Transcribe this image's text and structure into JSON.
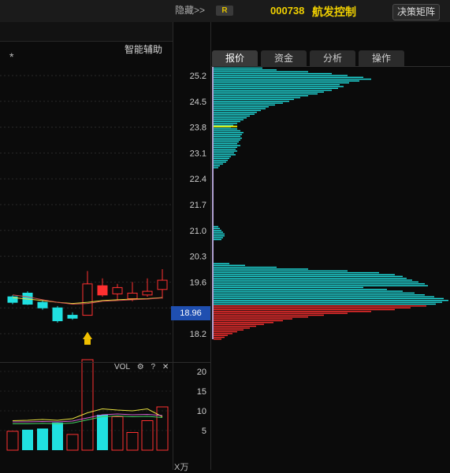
{
  "header": {
    "hide_label": "隐藏>>",
    "badge": "R",
    "code": "000738",
    "name": "航发控制",
    "matrix_button": "决策矩阵"
  },
  "chart": {
    "assist_label": "智能辅助",
    "star": "*",
    "current_price": "18.96",
    "vol_label": "VOL",
    "vol_icons": [
      "gear-icon",
      "help-icon",
      "close-icon"
    ],
    "unit_label": "X万"
  },
  "tabs": [
    "报价",
    "资金",
    "分析",
    "操作"
  ],
  "active_tab": 0,
  "colors": {
    "up": "#ff3030",
    "down": "#20e0e0",
    "price_tag": "#1f4fb0",
    "brand": "#f0d000"
  },
  "chart_data": {
    "type": "bar",
    "title": "",
    "price_ticks": [
      "25.2",
      "24.5",
      "23.8",
      "23.1",
      "22.4",
      "21.7",
      "21.0",
      "20.3",
      "19.6",
      "18.2"
    ],
    "volume_ticks": [
      "20",
      "15",
      "10",
      "5"
    ],
    "chip_distribution": {
      "y_range": [
        17.8,
        25.6
      ],
      "current": 18.96,
      "profit_color": "cyan",
      "loss_color": "red",
      "bars": [
        [
          25.5,
          28
        ],
        [
          25.45,
          45
        ],
        [
          25.4,
          62
        ],
        [
          25.35,
          80
        ],
        [
          25.3,
          120
        ],
        [
          25.25,
          150
        ],
        [
          25.2,
          170
        ],
        [
          25.15,
          190
        ],
        [
          25.1,
          200
        ],
        [
          25.05,
          185
        ],
        [
          25.0,
          172
        ],
        [
          24.95,
          160
        ],
        [
          24.9,
          165
        ],
        [
          24.85,
          158
        ],
        [
          24.8,
          150
        ],
        [
          24.75,
          140
        ],
        [
          24.7,
          132
        ],
        [
          24.65,
          120
        ],
        [
          24.6,
          110
        ],
        [
          24.55,
          102
        ],
        [
          24.5,
          96
        ],
        [
          24.45,
          88
        ],
        [
          24.4,
          78
        ],
        [
          24.35,
          70
        ],
        [
          24.3,
          66
        ],
        [
          24.25,
          60
        ],
        [
          24.2,
          55
        ],
        [
          24.15,
          52
        ],
        [
          24.1,
          46
        ],
        [
          24.05,
          42
        ],
        [
          24.0,
          38
        ],
        [
          23.95,
          34
        ],
        [
          23.9,
          30
        ],
        [
          23.85,
          25
        ],
        [
          23.8,
          22
        ],
        [
          23.75,
          30
        ],
        [
          23.7,
          34
        ],
        [
          23.65,
          38
        ],
        [
          23.6,
          36
        ],
        [
          23.55,
          34
        ],
        [
          23.5,
          36
        ],
        [
          23.45,
          34
        ],
        [
          23.4,
          32
        ],
        [
          23.35,
          30
        ],
        [
          23.3,
          34
        ],
        [
          23.25,
          30
        ],
        [
          23.2,
          28
        ],
        [
          23.15,
          30
        ],
        [
          23.1,
          26
        ],
        [
          23.05,
          28
        ],
        [
          23.0,
          22
        ],
        [
          22.95,
          20
        ],
        [
          22.9,
          18
        ],
        [
          22.85,
          16
        ],
        [
          22.8,
          12
        ],
        [
          22.75,
          8
        ],
        [
          22.7,
          6
        ],
        [
          21.1,
          6
        ],
        [
          21.05,
          8
        ],
        [
          21.0,
          10
        ],
        [
          20.95,
          12
        ],
        [
          20.9,
          14
        ],
        [
          20.85,
          14
        ],
        [
          20.8,
          12
        ],
        [
          20.75,
          10
        ],
        [
          20.1,
          20
        ],
        [
          20.05,
          40
        ],
        [
          20.0,
          80
        ],
        [
          19.95,
          120
        ],
        [
          19.9,
          170
        ],
        [
          19.85,
          210
        ],
        [
          19.8,
          230
        ],
        [
          19.75,
          240
        ],
        [
          19.7,
          245
        ],
        [
          19.65,
          252
        ],
        [
          19.6,
          260
        ],
        [
          19.55,
          268
        ],
        [
          19.5,
          272
        ],
        [
          19.45,
          190
        ],
        [
          19.4,
          220
        ],
        [
          19.35,
          240
        ],
        [
          19.3,
          255
        ],
        [
          19.25,
          268
        ],
        [
          19.2,
          280
        ],
        [
          19.15,
          292
        ],
        [
          19.1,
          298
        ],
        [
          19.05,
          290
        ],
        [
          19.0,
          282
        ],
        [
          18.95,
          270
        ],
        [
          18.9,
          250
        ],
        [
          18.85,
          230
        ],
        [
          18.8,
          200
        ],
        [
          18.75,
          170
        ],
        [
          18.7,
          140
        ],
        [
          18.65,
          120
        ],
        [
          18.6,
          100
        ],
        [
          18.55,
          88
        ],
        [
          18.5,
          76
        ],
        [
          18.45,
          64
        ],
        [
          18.4,
          54
        ],
        [
          18.35,
          46
        ],
        [
          18.3,
          38
        ],
        [
          18.25,
          30
        ],
        [
          18.2,
          24
        ],
        [
          18.15,
          18
        ],
        [
          18.1,
          14
        ],
        [
          18.05,
          10
        ]
      ]
    },
    "candles": [
      {
        "o": 19.2,
        "c": 19.05,
        "h": 19.24,
        "l": 19.0
      },
      {
        "o": 19.3,
        "c": 19.0,
        "h": 19.35,
        "l": 18.98
      },
      {
        "o": 19.05,
        "c": 18.9,
        "h": 19.12,
        "l": 18.85
      },
      {
        "o": 18.9,
        "c": 18.55,
        "h": 18.95,
        "l": 18.5
      },
      {
        "o": 18.7,
        "c": 18.62,
        "h": 18.78,
        "l": 18.58
      },
      {
        "o": 18.7,
        "c": 19.55,
        "h": 19.9,
        "l": 18.7
      },
      {
        "o": 19.25,
        "c": 19.5,
        "h": 19.7,
        "l": 19.2
      },
      {
        "o": 19.28,
        "c": 19.45,
        "h": 19.55,
        "l": 19.1
      },
      {
        "o": 19.15,
        "c": 19.3,
        "h": 19.6,
        "l": 19.08
      },
      {
        "o": 19.25,
        "c": 19.35,
        "h": 19.7,
        "l": 19.2
      },
      {
        "o": 19.4,
        "c": 19.65,
        "h": 19.95,
        "l": 19.15
      }
    ],
    "volumes": [
      {
        "v": 4.8,
        "up": true
      },
      {
        "v": 5.2,
        "up": false
      },
      {
        "v": 5.5,
        "up": false
      },
      {
        "v": 7.0,
        "up": false
      },
      {
        "v": 4.0,
        "up": true
      },
      {
        "v": 23.0,
        "up": true
      },
      {
        "v": 9.0,
        "up": false
      },
      {
        "v": 8.5,
        "up": true
      },
      {
        "v": 4.5,
        "up": true
      },
      {
        "v": 7.5,
        "up": true
      },
      {
        "v": 11.0,
        "up": true
      }
    ]
  }
}
